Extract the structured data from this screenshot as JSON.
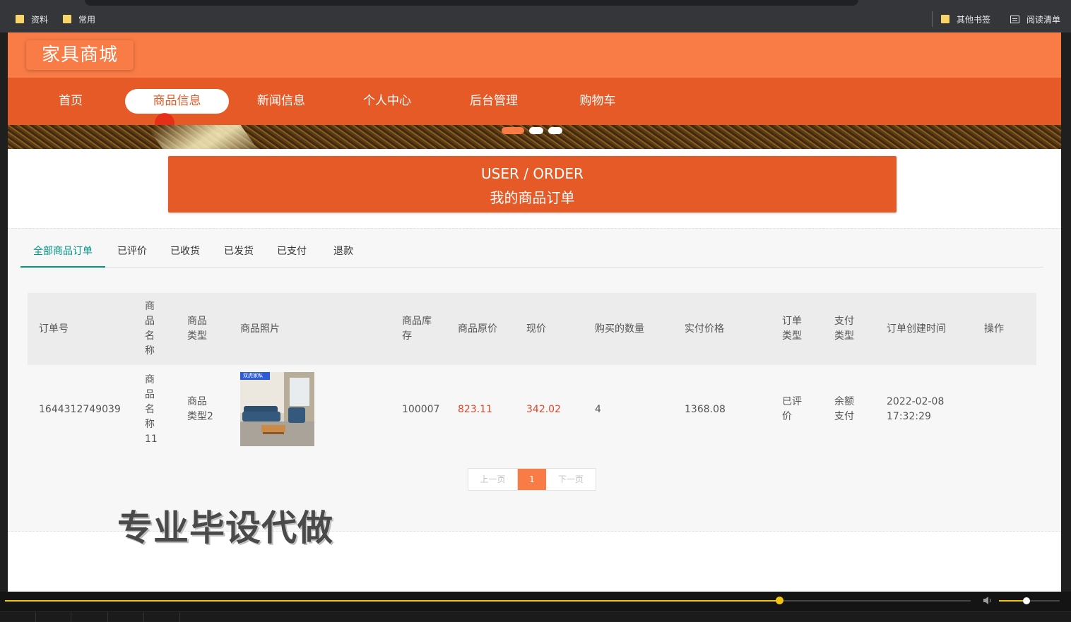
{
  "browser": {
    "bookmarks_left": [
      "资料",
      "常用"
    ],
    "bookmarks_right": [
      "其他书签",
      "阅读清单"
    ]
  },
  "site": {
    "logo": "家具商城",
    "nav": [
      "首页",
      "商品信息",
      "新闻信息",
      "个人中心",
      "后台管理",
      "购物车"
    ],
    "nav_active_index": 1
  },
  "title": {
    "en": "USER / ORDER",
    "cn": "我的商品订单"
  },
  "tabs": [
    "全部商品订单",
    "已评价",
    "已收货",
    "已发货",
    "已支付",
    "退款"
  ],
  "tabs_active_index": 0,
  "table": {
    "headers": [
      "订单号",
      "商品名称",
      "商品类型",
      "商品照片",
      "商品库存",
      "商品原价",
      "现价",
      "购买的数量",
      "实付价格",
      "订单类型",
      "支付类型",
      "订单创建时间",
      "操作"
    ],
    "row": {
      "order_no": "1644312749039",
      "name": "商品名称11",
      "type": "商品类型2",
      "photo_badge": "双虎家私",
      "stock": "100007",
      "orig_price": "823.11",
      "price": "342.02",
      "qty": "4",
      "paid": "1368.08",
      "order_type": "已评价",
      "pay_type": "余额支付",
      "created": "2022-02-08 17:32:29",
      "action": ""
    }
  },
  "pager": {
    "prev": "上一页",
    "current": "1",
    "next": "下一页"
  },
  "watermark": "专业毕设代做",
  "colors": {
    "primary": "#f97c46",
    "nav": "#e65a28",
    "tab_active": "#009688",
    "price_red": "#e0472a",
    "progress": "#f1c40f"
  },
  "player": {
    "progress": 0.73,
    "volume": 0.4
  }
}
